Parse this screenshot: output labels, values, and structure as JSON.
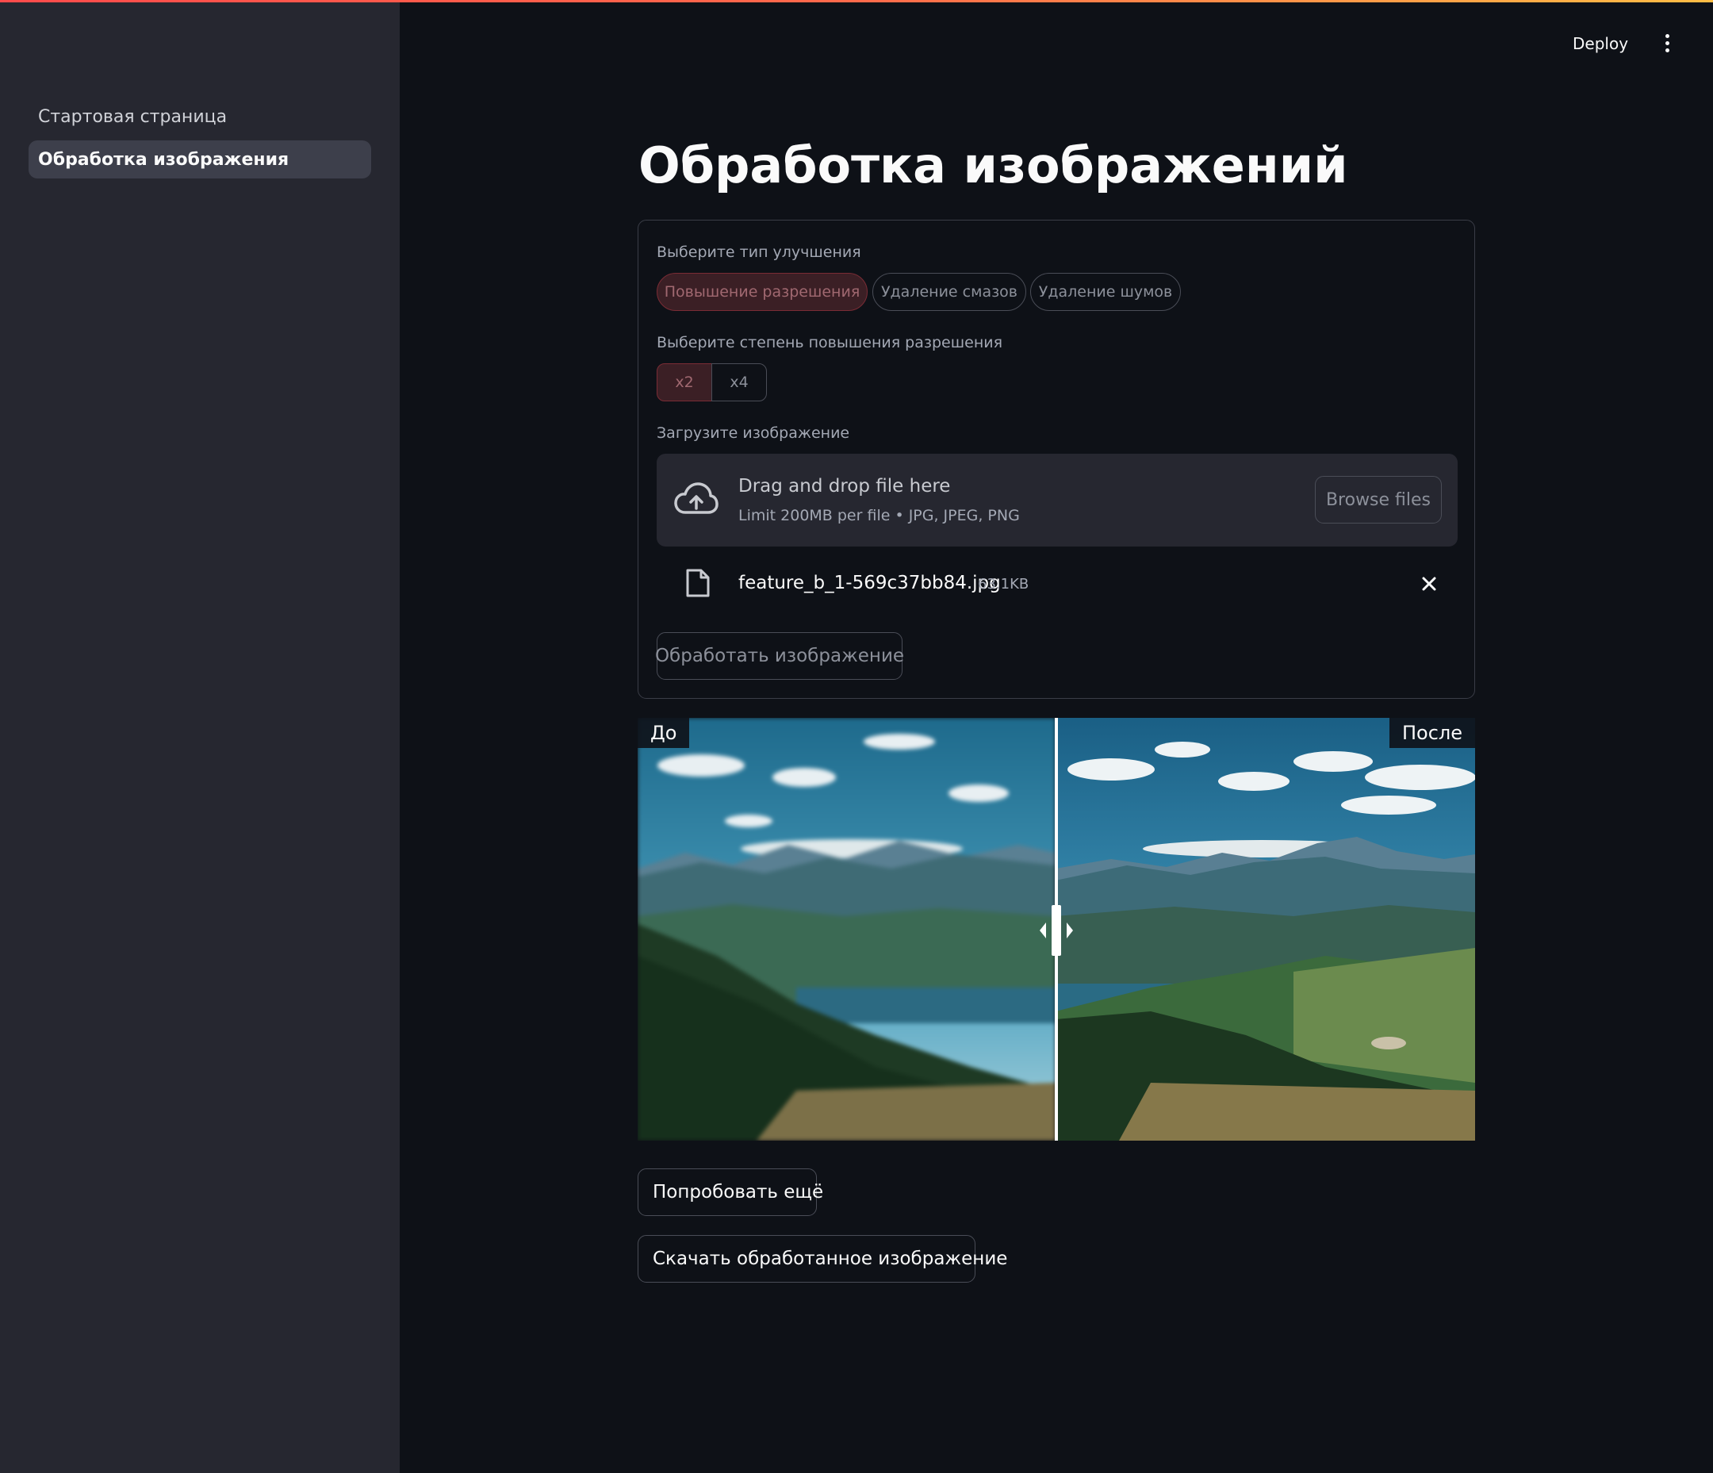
{
  "header": {
    "deploy_label": "Deploy",
    "menu_icon": "more-vertical-icon"
  },
  "sidebar": {
    "items": [
      {
        "label": "Стартовая страница",
        "active": false
      },
      {
        "label": "Обработка изображения",
        "active": true
      }
    ]
  },
  "main": {
    "title": "Обработка изображений",
    "form": {
      "enhancement_label": "Выберите тип улучшения",
      "enhancement_options": [
        "Повышение разрешения",
        "Удаление смазов",
        "Удаление шумов"
      ],
      "enhancement_selected": "Повышение разрешения",
      "scale_label": "Выберите степень повышения разрешения",
      "scale_options": [
        "x2",
        "x4"
      ],
      "scale_selected": "x2",
      "upload_label": "Загрузите изображение",
      "dropzone_title": "Drag and drop file here",
      "dropzone_limit": "Limit 200MB per file • JPG, JPEG, PNG",
      "browse_label": "Browse files",
      "file_name": "feature_b_1-569c37bb84.jpg",
      "file_size": "63.1KB",
      "process_label": "Обработать изображение"
    },
    "compare": {
      "before_label": "До",
      "after_label": "После",
      "slider_position": 0.5
    },
    "try_again_label": "Попробовать ещё",
    "download_label": "Скачать обработанное изображение"
  },
  "colors": {
    "background": "#0e1117",
    "sidebar": "#262730",
    "accent": "#ff4b4b",
    "selected_pill_bg": "#3b1f25"
  }
}
